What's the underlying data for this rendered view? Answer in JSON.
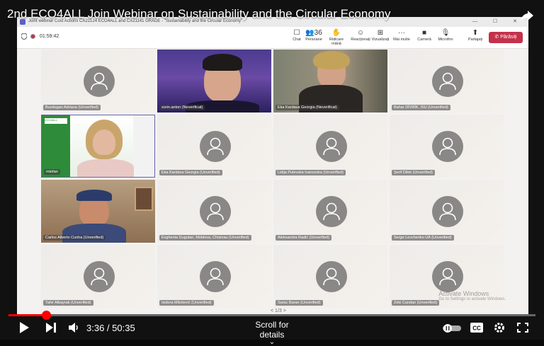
{
  "video": {
    "title": "2nd ECO4ALL Join Webinar on Sustainability and the Circular Economy"
  },
  "teams": {
    "window_title": "Joint webinar Cost Actions CA22124 ECO4ALL and CA21141 GRADE - \"Sustainability and the Circular Economy\"",
    "timer": "01:59:42",
    "toolbar": [
      {
        "icon": "chat-icon",
        "glyph": "☐",
        "label": "Chat"
      },
      {
        "icon": "people-icon",
        "glyph": "👥36",
        "label": "Persoane"
      },
      {
        "icon": "raise-hand-icon",
        "glyph": "✋",
        "label": "Ridicare mână"
      },
      {
        "icon": "reactions-icon",
        "glyph": "☺",
        "label": "Reacționați"
      },
      {
        "icon": "view-icon",
        "glyph": "⊞",
        "label": "Vizualizați"
      },
      {
        "icon": "more-icon",
        "glyph": "···",
        "label": "Mai multe"
      },
      {
        "icon": "camera-icon",
        "glyph": "■",
        "label": "Cameră"
      },
      {
        "icon": "microphone-icon",
        "glyph": "🎙",
        "label": "Microfon"
      },
      {
        "icon": "share-icon",
        "glyph": "⬆",
        "label": "Partajați"
      }
    ],
    "leave_label": "Părăsiți",
    "participants": [
      {
        "name": "Buzdugan Adriana (Unverified)",
        "type": "avatar"
      },
      {
        "name": "sorin.anton (Neverificat)",
        "type": "photo1"
      },
      {
        "name": "Eka Kardava Georgia (Neverificat)",
        "type": "photo2"
      },
      {
        "name": "Bahar DİVRİK, ISU (Unverified)",
        "type": "avatar"
      },
      {
        "name": "mtofan",
        "type": "photo3"
      },
      {
        "name": "Eka Kardava Georgia (Unverified)",
        "type": "avatar"
      },
      {
        "name": "Lidija Pulevska Ivanovska (Unverified)",
        "type": "avatar"
      },
      {
        "name": "Şerif Dilek (Unverified)",
        "type": "avatar"
      },
      {
        "name": "Carlos Alberto Cunha (Unverified)",
        "type": "photo4"
      },
      {
        "name": "Evghenia Gugulan, Moldova, Chisinau (Unverified)",
        "type": "avatar"
      },
      {
        "name": "Aleksandra Radić (Unverified)",
        "type": "avatar"
      },
      {
        "name": "Serge Levchenko UA (Unverified)",
        "type": "avatar"
      },
      {
        "name": "Tahir Albayrak (Unverified)",
        "type": "avatar"
      },
      {
        "name": "Isidora Milošević (Unverified)",
        "type": "avatar"
      },
      {
        "name": "Sarac Baran (Unverified)",
        "type": "avatar"
      },
      {
        "name": "Zeki Candan (Unverified)",
        "type": "avatar"
      }
    ],
    "pager": "1/3",
    "watermark_title": "Activate Windows",
    "watermark_sub": "Go to Settings to activate Windows."
  },
  "player": {
    "current_time": "3:36",
    "duration": "50:35",
    "time_text": "3:36 / 50:35",
    "progress_fraction": 0.0712,
    "scroll_hint": "Scroll for details"
  }
}
